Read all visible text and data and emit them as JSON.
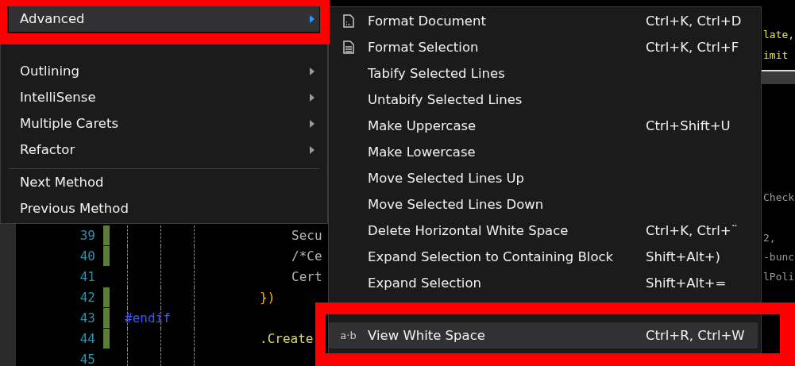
{
  "editor": {
    "lines": [
      {
        "number": "39",
        "changed": true,
        "code": "Secu",
        "kind": "plain"
      },
      {
        "number": "40",
        "changed": true,
        "code": "/*Ce",
        "kind": "plain"
      },
      {
        "number": "41",
        "changed": false,
        "code": "Cert",
        "kind": "plain"
      },
      {
        "number": "42",
        "changed": true,
        "code": "})",
        "kind": "brace"
      },
      {
        "number": "43",
        "changed": true,
        "code": "#endif",
        "kind": "directive"
      },
      {
        "number": "44",
        "changed": true,
        "code": ".Create",
        "kind": "member"
      },
      {
        "number": "45",
        "changed": false
      }
    ],
    "right_fragments": [
      {
        "text": "late,",
        "kind": "yellow"
      },
      {
        "text": "imit",
        "kind": "yellow"
      },
      {
        "text": "Check",
        "kind": "plain"
      },
      {
        "text": "2,",
        "kind": "plain"
      },
      {
        "text": "-bunc",
        "kind": "plain"
      },
      {
        "text": "lPoli",
        "kind": "plain"
      }
    ]
  },
  "context_menu": {
    "items": [
      {
        "label": "Advanced",
        "selected": true,
        "has_submenu": true,
        "separator_before": false
      },
      {
        "label": "Outlining",
        "selected": false,
        "has_submenu": true,
        "separator_before": false
      },
      {
        "label": "IntelliSense",
        "selected": false,
        "has_submenu": true,
        "separator_before": false
      },
      {
        "label": "Multiple Carets",
        "selected": false,
        "has_submenu": true,
        "separator_before": false
      },
      {
        "label": "Refactor",
        "selected": false,
        "has_submenu": true,
        "separator_before": false
      },
      {
        "label": "Next Method",
        "selected": false,
        "has_submenu": false,
        "separator_before": true
      },
      {
        "label": "Previous Method",
        "selected": false,
        "has_submenu": false,
        "separator_before": false
      }
    ]
  },
  "submenu": {
    "items": [
      {
        "label": "Format Document",
        "shortcut": "Ctrl+K, Ctrl+D",
        "selected": false
      },
      {
        "label": "Format Selection",
        "shortcut": "Ctrl+K, Ctrl+F",
        "selected": false
      },
      {
        "label": "Tabify Selected Lines",
        "selected": false
      },
      {
        "label": "Untabify Selected Lines",
        "selected": false
      },
      {
        "label": "Make Uppercase",
        "shortcut": "Ctrl+Shift+U",
        "selected": false
      },
      {
        "label": "Make Lowercase",
        "selected": false
      },
      {
        "label": "Move Selected Lines Up",
        "selected": false
      },
      {
        "label": "Move Selected Lines Down",
        "selected": false
      },
      {
        "label": "Delete Horizontal White Space",
        "shortcut": "Ctrl+K, Ctrl+¨",
        "selected": false
      },
      {
        "label": "Expand Selection to Containing Block",
        "shortcut": "Shift+Alt+)",
        "selected": false
      },
      {
        "label": "Expand Selection",
        "shortcut": "Shift+Alt+=",
        "selected": false
      },
      {
        "label": "View White Space",
        "shortcut": "Ctrl+R, Ctrl+W",
        "selected": true,
        "glyph": "a·b"
      }
    ]
  }
}
